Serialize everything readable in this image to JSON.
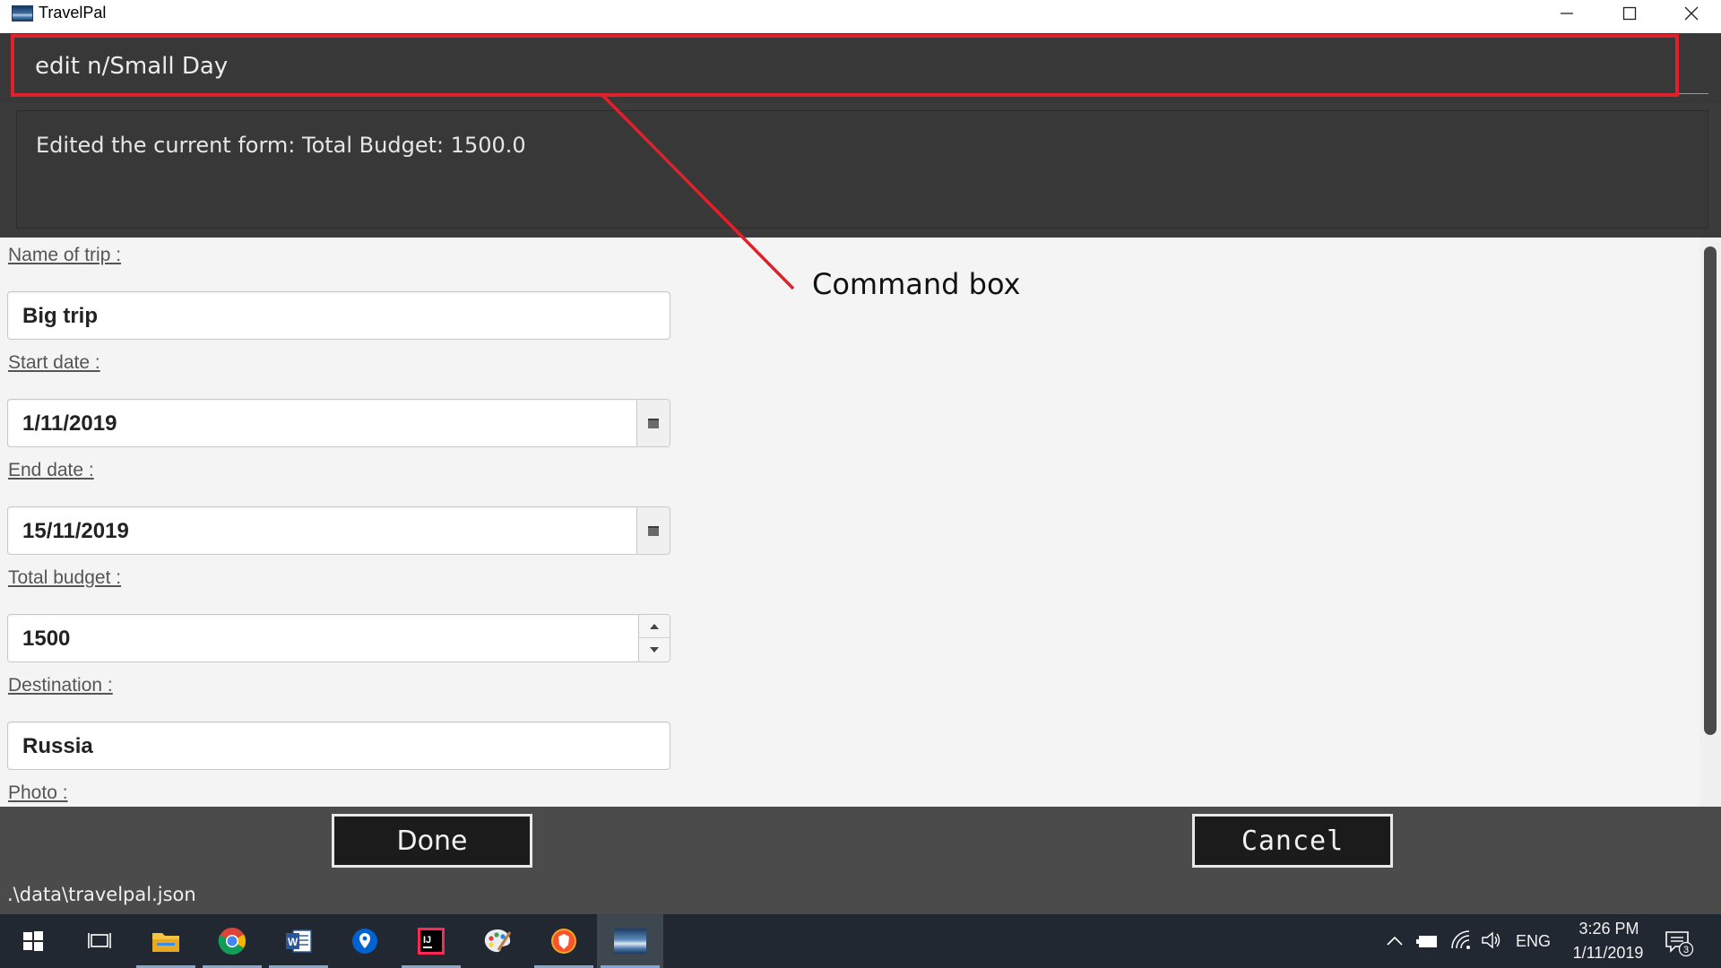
{
  "window": {
    "title": "TravelPal"
  },
  "command": {
    "value": "edit n/Small Day"
  },
  "result": {
    "text": "Edited the current form: Total Budget: 1500.0"
  },
  "form": {
    "fields": [
      {
        "label": "Name of trip :",
        "value": "Big trip"
      },
      {
        "label": "Start date :",
        "value": "1/11/2019"
      },
      {
        "label": "End date :",
        "value": "15/11/2019"
      },
      {
        "label": "Total budget :",
        "value": "1500"
      },
      {
        "label": "Destination :",
        "value": "Russia"
      },
      {
        "label": "Photo :"
      }
    ]
  },
  "buttons": {
    "done": "Done",
    "cancel": "Cancel"
  },
  "status": {
    "path": ".\\data\\travelpal.json"
  },
  "annotation": {
    "label": "Command box",
    "color": "#e0202a"
  },
  "taskbar": {
    "apps": [
      "windows-start",
      "task-view",
      "file-explorer",
      "chrome",
      "word",
      "maps",
      "intellij",
      "paint",
      "brave",
      "travelpal"
    ],
    "language": "ENG",
    "time": "3:26 PM",
    "date": "1/11/2019",
    "notification_count": "3"
  }
}
